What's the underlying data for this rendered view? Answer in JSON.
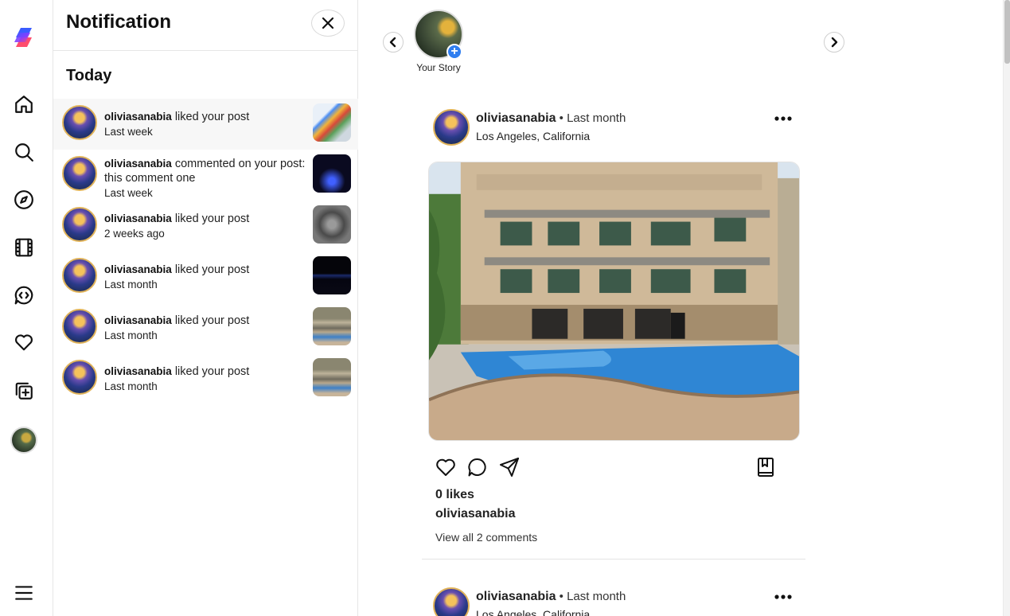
{
  "rail": {
    "items": [
      {
        "icon": "home-icon"
      },
      {
        "icon": "search-icon"
      },
      {
        "icon": "explore-icon"
      },
      {
        "icon": "reels-icon"
      },
      {
        "icon": "messages-icon"
      },
      {
        "icon": "heart-icon"
      },
      {
        "icon": "create-icon"
      }
    ],
    "menu_icon": "hamburger-menu-icon"
  },
  "notifications": {
    "title": "Notification",
    "section": "Today",
    "items": [
      {
        "user": "oliviasanabia",
        "action": " liked your post",
        "time": "Last week"
      },
      {
        "user": "oliviasanabia",
        "action": " commented on your post: this comment one",
        "time": "Last week"
      },
      {
        "user": "oliviasanabia",
        "action": " liked your post",
        "time": "2 weeks ago"
      },
      {
        "user": "oliviasanabia",
        "action": " liked your post",
        "time": "Last month"
      },
      {
        "user": "oliviasanabia",
        "action": " liked your post",
        "time": "Last month"
      },
      {
        "user": "oliviasanabia",
        "action": " liked your post",
        "time": "Last month"
      }
    ]
  },
  "stories": {
    "your_story_label": "Your Story",
    "add_symbol": "+"
  },
  "posts": [
    {
      "user": "oliviasanabia",
      "when": " • Last month",
      "location": "Los Angeles, California",
      "likes": "0 likes",
      "caption_user": "oliviasanabia",
      "comments_link": "View all 2 comments"
    },
    {
      "user": "oliviasanabia",
      "when": " • Last month",
      "location": "Los Angeles, California"
    }
  ]
}
